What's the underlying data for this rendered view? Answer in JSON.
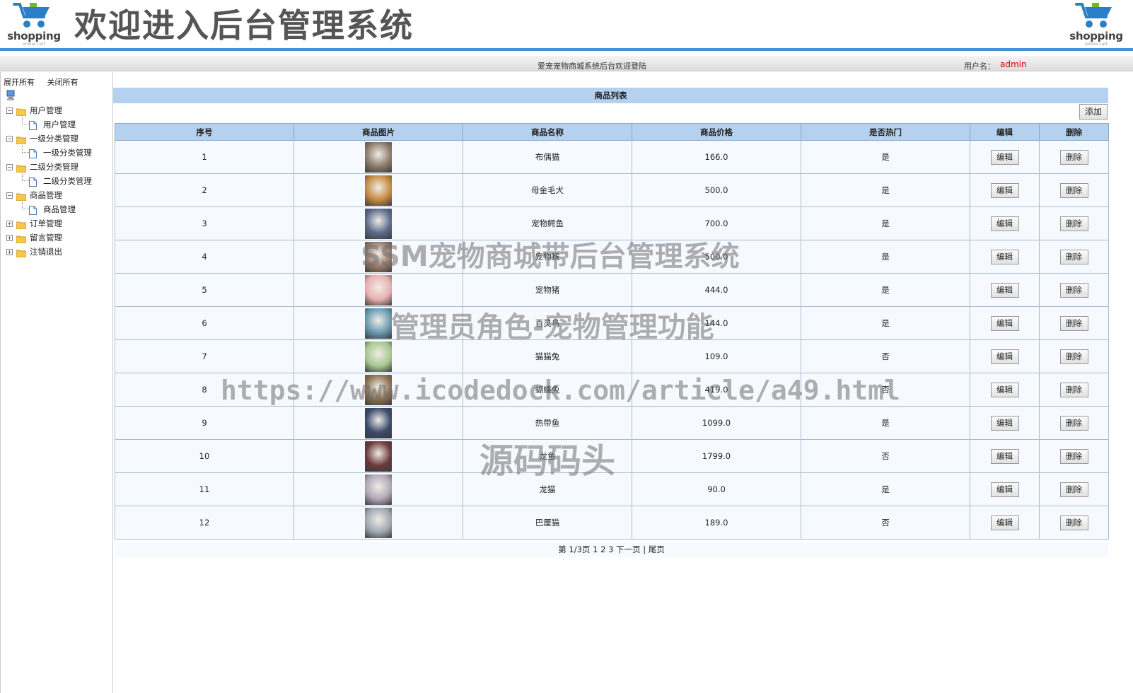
{
  "header": {
    "title": "欢迎进入后台管理系统",
    "logo_brand": "shopping",
    "logo_tagline": "online cart",
    "welcome": "爱宠宠物商城系统后台欢迎登陆",
    "user_label": "用户名：",
    "user_name": "admin"
  },
  "sidebar": {
    "expand_all": "展开所有",
    "collapse_all": "关闭所有",
    "groups": [
      {
        "label": "用户管理",
        "expanded": true,
        "children": [
          "用户管理"
        ]
      },
      {
        "label": "一级分类管理",
        "expanded": true,
        "children": [
          "一级分类管理"
        ]
      },
      {
        "label": "二级分类管理",
        "expanded": true,
        "children": [
          "二级分类管理"
        ]
      },
      {
        "label": "商品管理",
        "expanded": true,
        "children": [
          "商品管理"
        ]
      },
      {
        "label": "订单管理",
        "expanded": false,
        "children": []
      },
      {
        "label": "留言管理",
        "expanded": false,
        "children": []
      },
      {
        "label": "注销退出",
        "expanded": false,
        "children": []
      }
    ]
  },
  "main": {
    "list_title": "商品列表",
    "add_label": "添加",
    "columns": [
      "序号",
      "商品图片",
      "商品名称",
      "商品价格",
      "是否热门",
      "编辑",
      "删除"
    ],
    "edit_label": "编辑",
    "delete_label": "删除",
    "rows": [
      {
        "id": "1",
        "name": "布偶猫",
        "price": "166.0",
        "hot": "是",
        "thumb_color": "#8a7a6a"
      },
      {
        "id": "2",
        "name": "母金毛犬",
        "price": "500.0",
        "hot": "是",
        "thumb_color": "#c48a40"
      },
      {
        "id": "3",
        "name": "宠物鳄鱼",
        "price": "700.0",
        "hot": "是",
        "thumb_color": "#5a6a8a"
      },
      {
        "id": "4",
        "name": "宠物猴",
        "price": "500.0",
        "hot": "是",
        "thumb_color": "#9a7a6a"
      },
      {
        "id": "5",
        "name": "宠物猪",
        "price": "444.0",
        "hot": "是",
        "thumb_color": "#e8b0b0"
      },
      {
        "id": "6",
        "name": "百灵鸟",
        "price": "144.0",
        "hot": "是",
        "thumb_color": "#6a9ab0"
      },
      {
        "id": "7",
        "name": "猫猫兔",
        "price": "109.0",
        "hot": "否",
        "thumb_color": "#a8c890"
      },
      {
        "id": "8",
        "name": "蝴蝶兔",
        "price": "419.0",
        "hot": "否",
        "thumb_color": "#8a7050"
      },
      {
        "id": "9",
        "name": "热带鱼",
        "price": "1099.0",
        "hot": "是",
        "thumb_color": "#3a4a6a"
      },
      {
        "id": "10",
        "name": "龙鱼",
        "price": "1799.0",
        "hot": "否",
        "thumb_color": "#6a3a3a"
      },
      {
        "id": "11",
        "name": "龙猫",
        "price": "90.0",
        "hot": "是",
        "thumb_color": "#b0a8b8"
      },
      {
        "id": "12",
        "name": "巴厘猫",
        "price": "189.0",
        "hot": "否",
        "thumb_color": "#a0a8b0"
      }
    ],
    "pager": {
      "page_info": "第 1/3页",
      "pages": [
        "1",
        "2",
        "3"
      ],
      "next": "下一页",
      "separator": "|",
      "last": "尾页"
    }
  },
  "watermarks": {
    "line1": "SSM宠物商城带后台管理系统",
    "line2": "管理员角色-宠物管理功能",
    "line3": "https://www.icodedock.com/article/a49.html",
    "line4": "源码码头"
  },
  "colors": {
    "header_bar": "#4a90d9",
    "list_header": "#b4d1f0",
    "user_name": "#d40000"
  }
}
